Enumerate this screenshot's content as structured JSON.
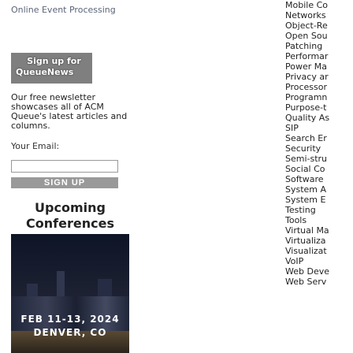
{
  "top_link": "Online Event Processing",
  "signup_banner": {
    "line1": "Sign up for",
    "line2": "QueueNews"
  },
  "newsletter_text": "Our free newsletter showcases all of ACM Queue's latest articles and columns.",
  "email": {
    "label": "Your Email:",
    "value": ""
  },
  "signup_button": "SIGN UP",
  "conferences": {
    "heading": "Upcoming Conferences",
    "date": "FEB 11-13, 2024",
    "location": "DENVER, CO"
  },
  "topics": [
    "Mobile Co",
    "Networks",
    "Object-Re",
    "Open Sou",
    "Patching ",
    "Performar",
    "Power Ma",
    "Privacy ar",
    "Processor",
    "Programn",
    "Purpose-t",
    "Quality As",
    "SIP",
    "Search Er",
    "Security",
    "Semi-stru",
    "Social Co",
    "Software",
    "System A",
    "System E",
    "Testing",
    "Tools",
    "Virtual Ma",
    "Virtualiza",
    "Visualizat",
    "VoIP",
    "Web Deve",
    "Web Serv"
  ]
}
